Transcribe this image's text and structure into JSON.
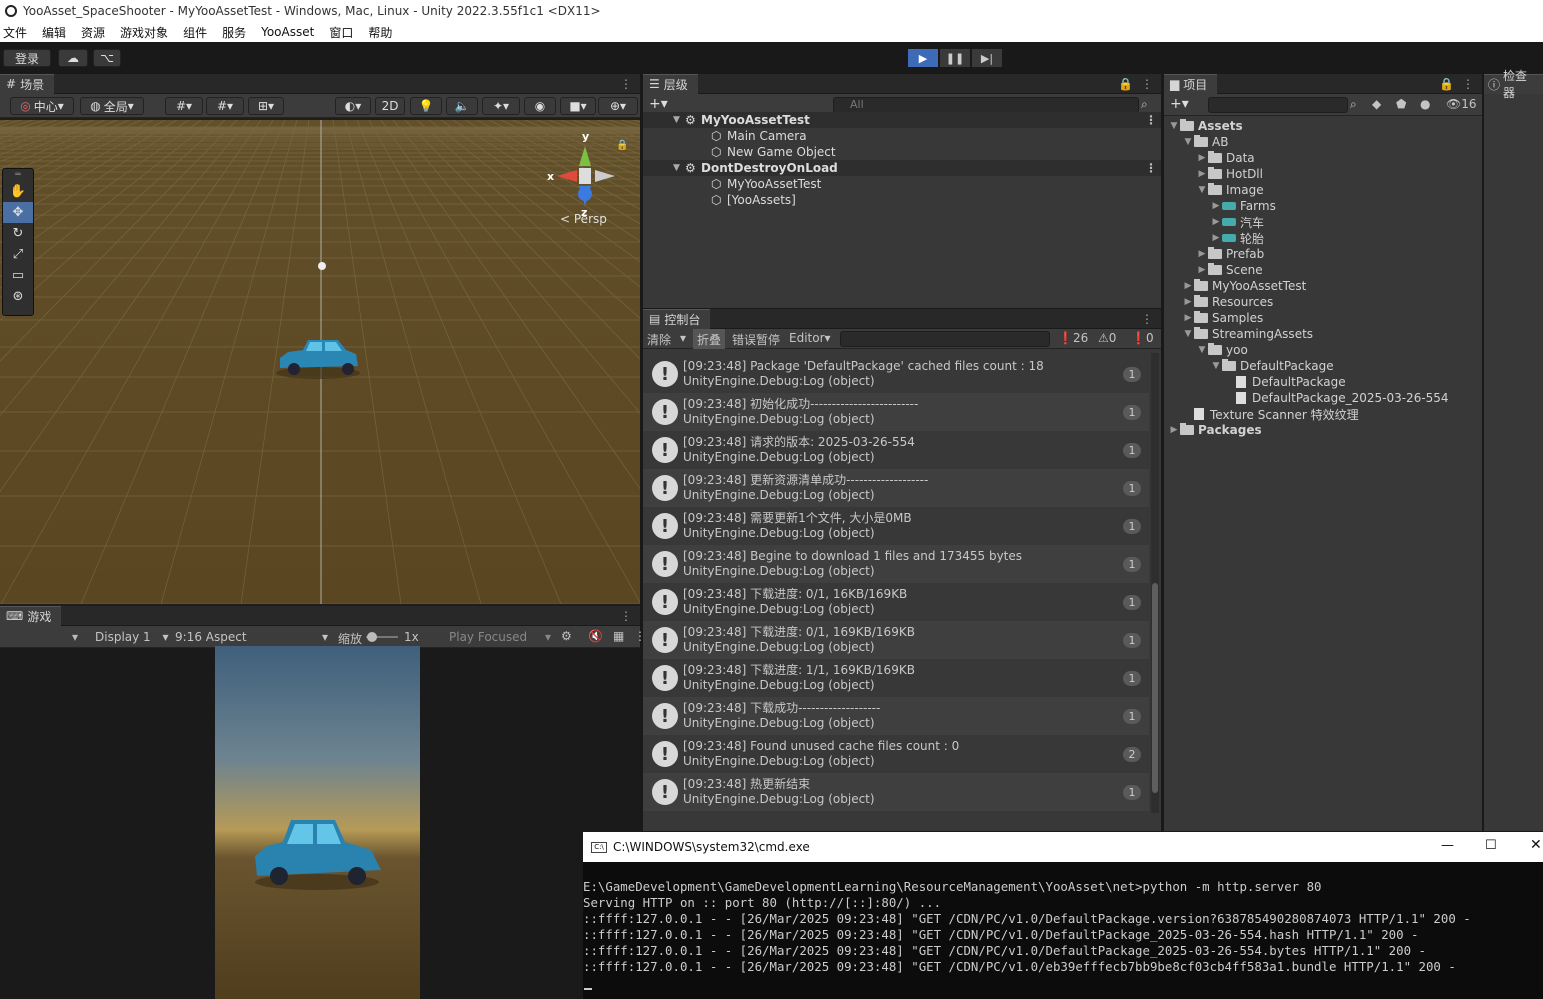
{
  "window": {
    "title": "YooAsset_SpaceShooter - MyYooAssetTest - Windows, Mac, Linux - Unity 2022.3.55f1c1 <DX11>"
  },
  "menu": [
    "文件",
    "编辑",
    "资源",
    "游戏对象",
    "组件",
    "服务",
    "YooAsset",
    "窗口",
    "帮助"
  ],
  "toolbar": {
    "login": "登录"
  },
  "scene": {
    "tab": "场景",
    "pivot": "中心",
    "global": "全局",
    "mode2d": "2D",
    "persp": "Persp",
    "axes": {
      "x": "x",
      "y": "y",
      "z": "z"
    }
  },
  "game": {
    "tab": "游戏",
    "display": "Display 1",
    "aspect": "9:16 Aspect",
    "scale_label": "缩放",
    "scale_value": "1x",
    "play_focused": "Play Focused"
  },
  "hierarchy": {
    "tab": "层级",
    "search_placeholder": "All",
    "rows": [
      {
        "label": "MyYooAssetTest",
        "type": "scene"
      },
      {
        "label": "Main Camera",
        "type": "object"
      },
      {
        "label": "New Game Object",
        "type": "object"
      },
      {
        "label": "DontDestroyOnLoad",
        "type": "scene"
      },
      {
        "label": "MyYooAssetTest",
        "type": "object"
      },
      {
        "label": "[YooAssets]",
        "type": "object"
      }
    ]
  },
  "console": {
    "tab": "控制台",
    "clear": "清除",
    "collapse": "折叠",
    "error_pause": "错误暂停",
    "editor": "Editor",
    "counts": {
      "log": "26",
      "warn": "0",
      "error": "0"
    },
    "logs": [
      {
        "line1": "[09:23:48] Package 'DefaultPackage' cached files count : 18",
        "line2": "UnityEngine.Debug:Log (object)",
        "count": "1"
      },
      {
        "line1": "[09:23:48] 初始化成功-------------------------",
        "line2": "UnityEngine.Debug:Log (object)",
        "count": "1"
      },
      {
        "line1": "[09:23:48] 请求的版本: 2025-03-26-554",
        "line2": "UnityEngine.Debug:Log (object)",
        "count": "1"
      },
      {
        "line1": "[09:23:48] 更新资源清单成功-------------------",
        "line2": "UnityEngine.Debug:Log (object)",
        "count": "1"
      },
      {
        "line1": "[09:23:48] 需要更新1个文件, 大小是0MB",
        "line2": "UnityEngine.Debug:Log (object)",
        "count": "1"
      },
      {
        "line1": "[09:23:48] Begine to download 1 files and 173455 bytes",
        "line2": "UnityEngine.Debug:Log (object)",
        "count": "1"
      },
      {
        "line1": "[09:23:48] 下载进度: 0/1, 16KB/169KB",
        "line2": "UnityEngine.Debug:Log (object)",
        "count": "1"
      },
      {
        "line1": "[09:23:48] 下载进度: 0/1, 169KB/169KB",
        "line2": "UnityEngine.Debug:Log (object)",
        "count": "1"
      },
      {
        "line1": "[09:23:48] 下载进度: 1/1, 169KB/169KB",
        "line2": "UnityEngine.Debug:Log (object)",
        "count": "1"
      },
      {
        "line1": "[09:23:48] 下载成功-------------------",
        "line2": "UnityEngine.Debug:Log (object)",
        "count": "1"
      },
      {
        "line1": "[09:23:48] Found unused cache files count : 0",
        "line2": "UnityEngine.Debug:Log (object)",
        "count": "2"
      },
      {
        "line1": "[09:23:48] 热更新结束",
        "line2": "UnityEngine.Debug:Log (object)",
        "count": "1"
      }
    ]
  },
  "project": {
    "tab": "项目",
    "hidden_count": "16",
    "tree": [
      {
        "label": "Assets",
        "depth": 0,
        "kind": "folder-open",
        "bold": true
      },
      {
        "label": "AB",
        "depth": 1,
        "kind": "folder-open"
      },
      {
        "label": "Data",
        "depth": 2,
        "kind": "folder"
      },
      {
        "label": "HotDll",
        "depth": 2,
        "kind": "folder"
      },
      {
        "label": "Image",
        "depth": 2,
        "kind": "folder-open"
      },
      {
        "label": "Farms",
        "depth": 3,
        "kind": "sprite"
      },
      {
        "label": "汽车",
        "depth": 3,
        "kind": "sprite"
      },
      {
        "label": "轮胎",
        "depth": 3,
        "kind": "sprite"
      },
      {
        "label": "Prefab",
        "depth": 2,
        "kind": "folder"
      },
      {
        "label": "Scene",
        "depth": 2,
        "kind": "folder"
      },
      {
        "label": "MyYooAssetTest",
        "depth": 1,
        "kind": "folder"
      },
      {
        "label": "Resources",
        "depth": 1,
        "kind": "folder"
      },
      {
        "label": "Samples",
        "depth": 1,
        "kind": "folder"
      },
      {
        "label": "StreamingAssets",
        "depth": 1,
        "kind": "folder-open"
      },
      {
        "label": "yoo",
        "depth": 2,
        "kind": "folder-open"
      },
      {
        "label": "DefaultPackage",
        "depth": 3,
        "kind": "folder-open"
      },
      {
        "label": "DefaultPackage",
        "depth": 4,
        "kind": "file"
      },
      {
        "label": "DefaultPackage_2025-03-26-554",
        "depth": 4,
        "kind": "file"
      },
      {
        "label": "Texture Scanner 特效纹理",
        "depth": 1,
        "kind": "doc"
      },
      {
        "label": "Packages",
        "depth": 0,
        "kind": "folder",
        "bold": true
      }
    ]
  },
  "inspector": {
    "tab": "检查器"
  },
  "cmd": {
    "title": "C:\\WINDOWS\\system32\\cmd.exe",
    "lines": [
      "E:\\GameDevelopment\\GameDevelopmentLearning\\ResourceManagement\\YooAsset\\net>python -m http.server 80",
      "Serving HTTP on :: port 80 (http://[::]:80/) ...",
      "::ffff:127.0.0.1 - - [26/Mar/2025 09:23:48] \"GET /CDN/PC/v1.0/DefaultPackage.version?638785490280874073 HTTP/1.1\" 200 -",
      "::ffff:127.0.0.1 - - [26/Mar/2025 09:23:48] \"GET /CDN/PC/v1.0/DefaultPackage_2025-03-26-554.hash HTTP/1.1\" 200 -",
      "::ffff:127.0.0.1 - - [26/Mar/2025 09:23:48] \"GET /CDN/PC/v1.0/DefaultPackage_2025-03-26-554.bytes HTTP/1.1\" 200 -",
      "::ffff:127.0.0.1 - - [26/Mar/2025 09:23:48] \"GET /CDN/PC/v1.0/eb39efffecb7bb9be8cf03cb4ff583a1.bundle HTTP/1.1\" 200 -"
    ]
  },
  "colors": {
    "accent": "#4d7bd0",
    "scene_ground": "#5a4620",
    "sky_top": "#3d5c7a"
  }
}
